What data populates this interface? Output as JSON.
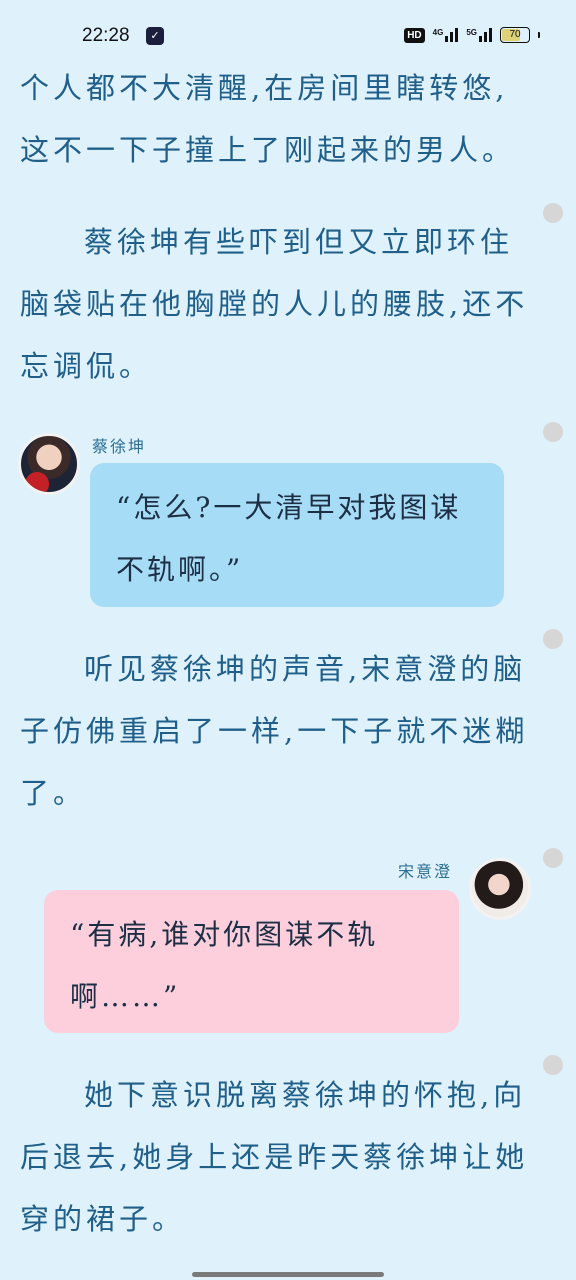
{
  "status_bar": {
    "time": "22:28",
    "hd": "HD",
    "net1": "4G",
    "net2": "5G",
    "battery": "70",
    "battery_level": 0.7
  },
  "story": {
    "p1": "个人都不大清醒,在房间里瞎转悠,这不一下子撞上了刚起来的男人。",
    "p2": "蔡徐坤有些吓到但又立即环住脑袋贴在他胸膛的人儿的腰肢,还不忘调侃。",
    "dialog1": {
      "speaker": "蔡徐坤",
      "text": "“怎么?一大清早对我图谋不轨啊。”"
    },
    "p3": "听见蔡徐坤的声音,宋意澄的脑子仿佛重启了一样,一下子就不迷糊了。",
    "dialog2": {
      "speaker": "宋意澄",
      "text": "“有病,谁对你图谋不轨啊……”"
    },
    "p4": "她下意识脱离蔡徐坤的怀抱,向后退去,她身上还是昨天蔡徐坤让她穿的裙子。"
  },
  "colors": {
    "background": "#dff1fb",
    "text": "#1f5f8a",
    "bubble_blue": "#a7dcf6",
    "bubble_pink": "#fdcfdd"
  }
}
